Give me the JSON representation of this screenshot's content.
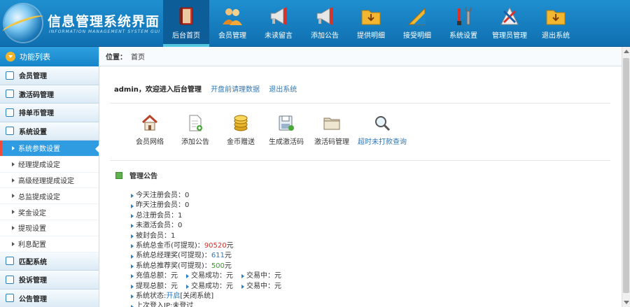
{
  "header": {
    "title": "信息管理系统界面",
    "subtitle": "INFORMATION MANAGEMENT SYSTEM GUI",
    "nav": [
      {
        "label": "后台首页",
        "icon": "book-icon",
        "active": true
      },
      {
        "label": "会员管理",
        "icon": "users-icon"
      },
      {
        "label": "未读留言",
        "icon": "megaphone-icon"
      },
      {
        "label": "添加公告",
        "icon": "megaphone-add-icon"
      },
      {
        "label": "提供明细",
        "icon": "folder-down-icon"
      },
      {
        "label": "接受明细",
        "icon": "ruler-icon"
      },
      {
        "label": "系统设置",
        "icon": "tools-icon"
      },
      {
        "label": "管理员管理",
        "icon": "admin-tools-icon"
      },
      {
        "label": "退出系统",
        "icon": "exit-folder-icon"
      }
    ]
  },
  "sidebar": {
    "header": "功能列表",
    "items": [
      {
        "label": "会员管理",
        "type": "group"
      },
      {
        "label": "激活码管理",
        "type": "group"
      },
      {
        "label": "排单币管理",
        "type": "group"
      },
      {
        "label": "系统设置",
        "type": "group"
      },
      {
        "label": "系统参数设置",
        "type": "sub",
        "active": true
      },
      {
        "label": "经理提成设定",
        "type": "sub"
      },
      {
        "label": "高级经理提成设定",
        "type": "sub"
      },
      {
        "label": "总监提成设定",
        "type": "sub"
      },
      {
        "label": "奖金设定",
        "type": "sub"
      },
      {
        "label": "提现设置",
        "type": "sub"
      },
      {
        "label": "利息配置",
        "type": "sub"
      },
      {
        "label": "匹配系统",
        "type": "group"
      },
      {
        "label": "投诉管理",
        "type": "group"
      },
      {
        "label": "公告管理",
        "type": "group"
      }
    ]
  },
  "breadcrumb": {
    "label": "位置：",
    "current": "首页"
  },
  "welcome": {
    "text": "admin，欢迎进入后台管理",
    "link1": "开盘前请理数据",
    "link2": "退出系统"
  },
  "quick": [
    {
      "label": "会员网络",
      "icon": "house-icon"
    },
    {
      "label": "添加公告",
      "icon": "doc-add-icon"
    },
    {
      "label": "金币赠送",
      "icon": "coins-icon"
    },
    {
      "label": "生成激活码",
      "icon": "save-disk-icon"
    },
    {
      "label": "激活码管理",
      "icon": "folder-icon"
    },
    {
      "label": "超时未打款查询",
      "icon": "magnifier-icon"
    }
  ],
  "notice": {
    "title": "管理公告",
    "lines": [
      [
        {
          "k": "今天注册会员：",
          "v": "0"
        }
      ],
      [
        {
          "k": "昨天注册会员：",
          "v": "0"
        }
      ],
      [
        {
          "k": "总注册会员：",
          "v": "1"
        }
      ],
      [
        {
          "k": "未激活会员：",
          "v": "0"
        }
      ],
      [
        {
          "k": "被封会员：",
          "v": "1"
        }
      ],
      [
        {
          "k": "系统总金币(可提现)：",
          "v": "90520",
          "suffix": "元",
          "color": "red"
        }
      ],
      [
        {
          "k": "系统总经理奖(可提现)：",
          "v": "611",
          "suffix": "元",
          "color": "blue"
        }
      ],
      [
        {
          "k": "系统总推荐奖(可提现)：",
          "v": "500",
          "suffix": "元",
          "color": "green"
        }
      ],
      [
        {
          "k": "充值总额：",
          "v": "元"
        },
        {
          "k": "交易成功：",
          "v": "元"
        },
        {
          "k": "交易中：",
          "v": "元"
        }
      ],
      [
        {
          "k": "提现总额：",
          "v": "元"
        },
        {
          "k": "交易成功：",
          "v": "元"
        },
        {
          "k": "交易中：",
          "v": "元"
        }
      ],
      [
        {
          "k": "系统状态:",
          "v": "开启",
          "suffix": " [关闭系统]",
          "color": "blue"
        }
      ],
      [
        {
          "k": "上次登入IP:",
          "v": "未登过"
        }
      ]
    ]
  },
  "colors": {
    "header_bg": "#1a85c8",
    "sidebar_active": "#2f9be0",
    "accent_red": "#d0302a"
  }
}
